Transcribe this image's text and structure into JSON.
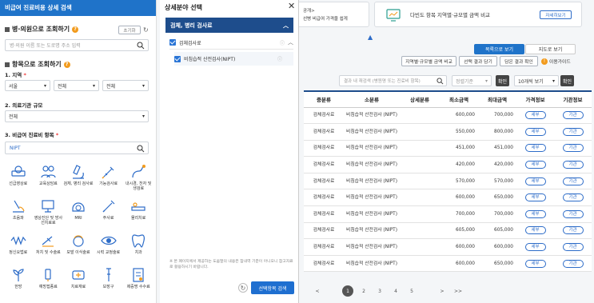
{
  "left": {
    "title": "비급여 진료비용 상세 검색",
    "by_hospital": "병·의원으로 조회하기",
    "reset_label": "초기화",
    "hospital_placeholder": "병·의원 이름 또는 도로명 주소 입력",
    "by_item": "항목으로 조회하기",
    "region_label": "1. 지역",
    "region_values": [
      "서울",
      "전체",
      "전체"
    ],
    "size_label": "2. 의료기관 규모",
    "size_value": "전체",
    "item_label": "3. 비급여 진료비 항목",
    "item_value": "NIPT",
    "categories": [
      {
        "label": "선급영상료",
        "icon": "scanner-icon"
      },
      {
        "label": "교육상담료",
        "icon": "consult-icon"
      },
      {
        "label": "검체, 병리 검사료",
        "icon": "microscope-icon"
      },
      {
        "label": "기능검사료",
        "icon": "syringe-icon"
      },
      {
        "label": "내시경, 천자 및 생검료",
        "icon": "endoscope-icon"
      },
      {
        "label": "초음파",
        "icon": "ultrasound-icon"
      },
      {
        "label": "영상진단 및 방사선치료료",
        "icon": "xray-icon"
      },
      {
        "label": "MRI",
        "icon": "mri-icon"
      },
      {
        "label": "주사료",
        "icon": "injection-icon"
      },
      {
        "label": "물리치료",
        "icon": "therapy-icon"
      },
      {
        "label": "정신요법료",
        "icon": "brainwave-icon"
      },
      {
        "label": "처치 및 수술료",
        "icon": "surgery-icon"
      },
      {
        "label": "모발 이식술료",
        "icon": "hair-icon"
      },
      {
        "label": "시력 교정술료",
        "icon": "eye-icon"
      },
      {
        "label": "치과",
        "icon": "tooth-icon"
      },
      {
        "label": "한방",
        "icon": "herbal-icon"
      },
      {
        "label": "예방접종료",
        "icon": "vaccine-icon"
      },
      {
        "label": "치료재료",
        "icon": "material-icon"
      },
      {
        "label": "보장구",
        "icon": "crutch-icon"
      },
      {
        "label": "제증명 수수료",
        "icon": "certificate-icon"
      }
    ]
  },
  "mid": {
    "title": "상세분야 선택",
    "group": "검체, 병리 검사료",
    "sub": "검체검사료",
    "item": "비침습적 산전검사(NIPT)",
    "note": "※ 본 페이지에서 제공하는 도움말의 내용은 참내역 기준이 아니오니 참고자료로 활용하시기 바랍니다.",
    "apply": "선택항목 검색"
  },
  "right": {
    "banner1_line1": "공개>",
    "banner1_line2": "선병 비급여 가격을 쉽게",
    "banner2_text": "다빈도 항목 지역별·규모별 금액 비교",
    "banner2_btn": "자세히보기",
    "tab_list": "목록으로 보기",
    "tab_map": "지도로 보기",
    "btn_compare": "지역별·규모별 금액 비교",
    "btn_save": "선택 결과 담기",
    "btn_check": "담은 결과 확인",
    "btn_guide": "이용가이드",
    "search_placeholder": "결과 내 재검색 (병원명 또는 진료비 항목)",
    "sort_placeholder": "정렬기준",
    "confirm": "확인",
    "per_page": "10개씩 보기",
    "columns": [
      "중분류",
      "소분류",
      "상세분류",
      "최소금액",
      "최대금액",
      "가격정보",
      "기관정보"
    ],
    "rows": [
      [
        "검체검사료",
        "비침습적 산전검사 (NIPT)",
        "",
        "600,000",
        "700,000",
        "세부",
        "기관"
      ],
      [
        "검체검사료",
        "비침습적 산전검사 (NIPT)",
        "",
        "550,000",
        "800,000",
        "세부",
        "기관"
      ],
      [
        "검체검사료",
        "비침습적 산전검사 (NIPT)",
        "",
        "451,000",
        "451,000",
        "세부",
        "기관"
      ],
      [
        "검체검사료",
        "비침습적 산전검사 (NIPT)",
        "",
        "420,000",
        "420,000",
        "세부",
        "기관"
      ],
      [
        "검체검사료",
        "비침습적 산전검사 (NIPT)",
        "",
        "570,000",
        "570,000",
        "세부",
        "기관"
      ],
      [
        "검체검사료",
        "비침습적 산전검사 (NIPT)",
        "",
        "600,000",
        "650,000",
        "세부",
        "기관"
      ],
      [
        "검체검사료",
        "비침습적 산전검사 (NIPT)",
        "",
        "700,000",
        "700,000",
        "세부",
        "기관"
      ],
      [
        "검체검사료",
        "비침습적 산전검사 (NIPT)",
        "",
        "605,000",
        "605,000",
        "세부",
        "기관"
      ],
      [
        "검체검사료",
        "비침습적 산전검사 (NIPT)",
        "",
        "600,000",
        "600,000",
        "세부",
        "기관"
      ],
      [
        "검체검사료",
        "비침습적 산전검사 (NIPT)",
        "",
        "600,000",
        "650,000",
        "세부",
        "기관"
      ]
    ],
    "pages": [
      "1",
      "2",
      "3",
      "4",
      "5"
    ],
    "prev": "<",
    "next": ">",
    "last": ">>"
  },
  "colors": {
    "primary": "#1f73c9",
    "dark_blue": "#1e4d8c",
    "accent": "#f29b1d"
  }
}
